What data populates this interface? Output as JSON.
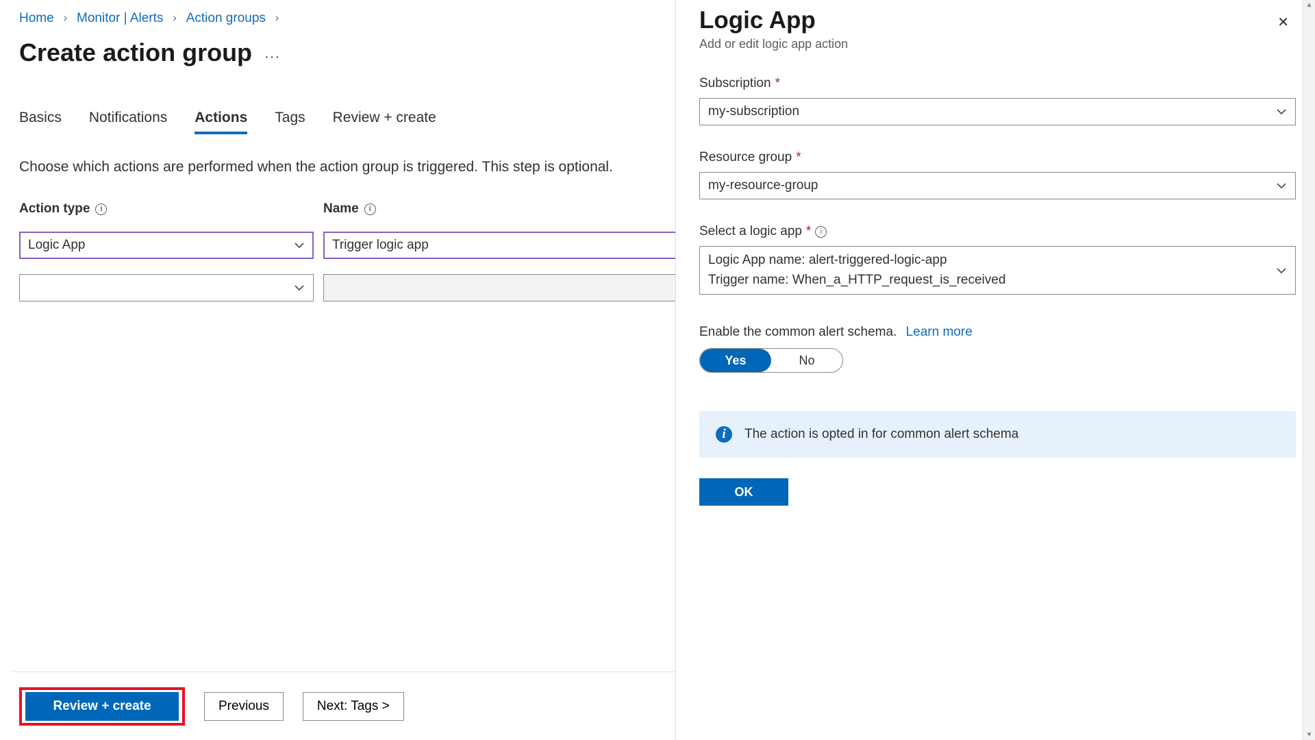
{
  "breadcrumb": {
    "home": "Home",
    "monitor": "Monitor | Alerts",
    "action_groups": "Action groups"
  },
  "page": {
    "title": "Create action group",
    "description": "Choose which actions are performed when the action group is triggered. This step is optional."
  },
  "tabs": {
    "basics": "Basics",
    "notifications": "Notifications",
    "actions": "Actions",
    "tags": "Tags",
    "review": "Review + create"
  },
  "table": {
    "action_type_header": "Action type",
    "name_header": "Name",
    "row1_actiontype": "Logic App",
    "row1_name": "Trigger logic app"
  },
  "footer": {
    "review_create": "Review + create",
    "previous": "Previous",
    "next": "Next: Tags >"
  },
  "panel": {
    "title": "Logic App",
    "subtitle": "Add or edit logic app action",
    "subscription_label": "Subscription",
    "subscription_value": "my-subscription",
    "rg_label": "Resource group",
    "rg_value": "my-resource-group",
    "logicapp_label": "Select a logic app",
    "logicapp_line1": "Logic App name: alert-triggered-logic-app",
    "logicapp_line2": "Trigger name: When_a_HTTP_request_is_received",
    "schema_label": "Enable the common alert schema.",
    "learn_more": "Learn more",
    "toggle_yes": "Yes",
    "toggle_no": "No",
    "notice_text": "The action is opted in for common alert schema",
    "ok": "OK"
  }
}
